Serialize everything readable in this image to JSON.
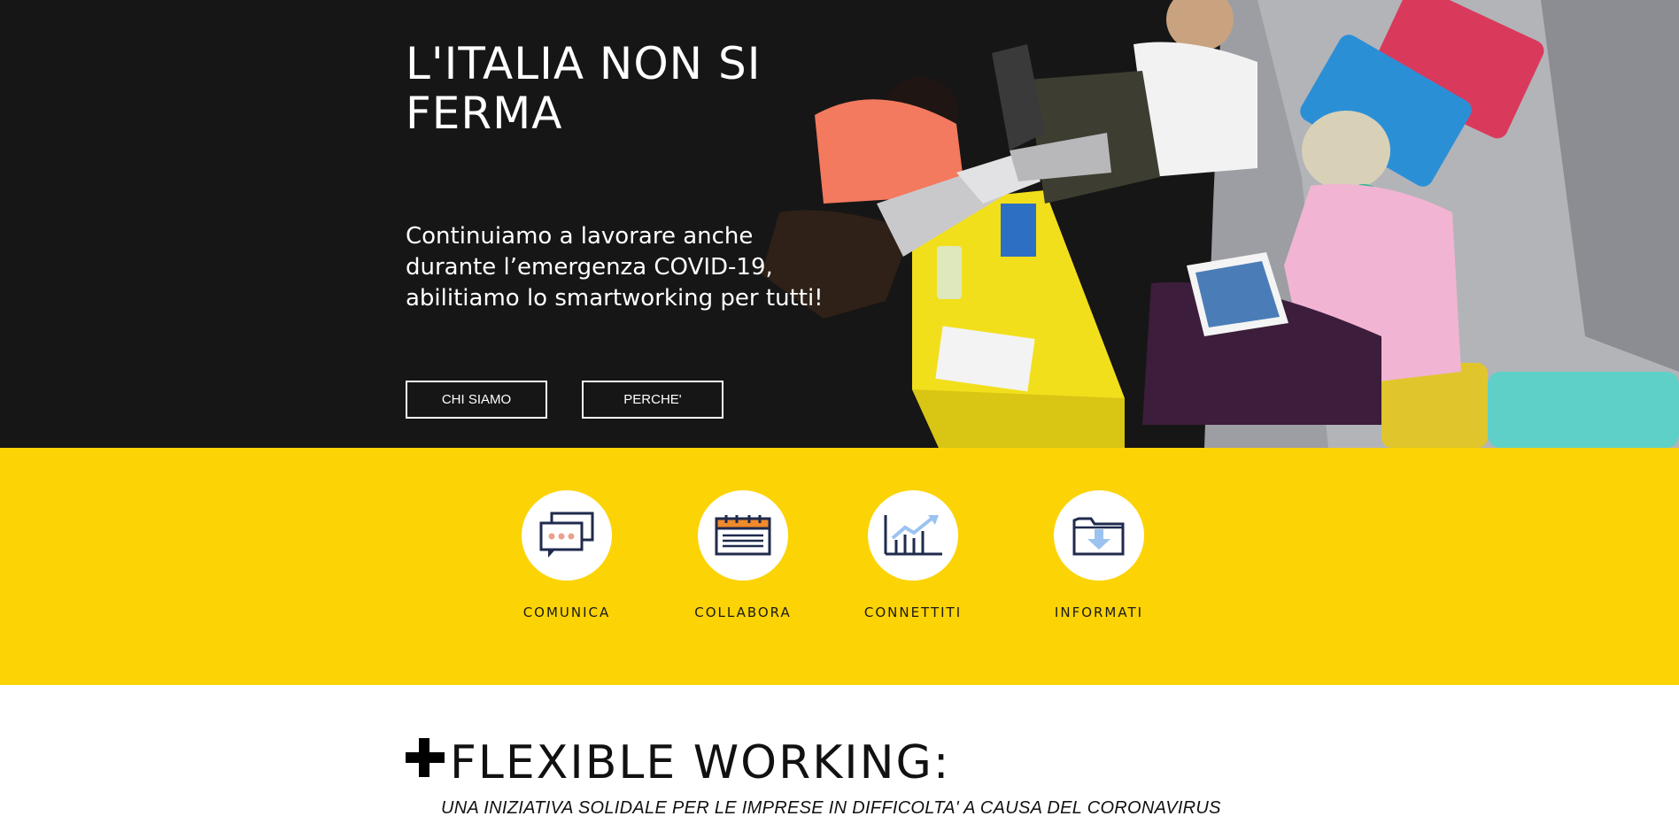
{
  "hero": {
    "title": "L'ITALIA NON SI FERMA",
    "subtitle": "Continuiamo a lavorare anche durante l’emergenza COVID-19, abilitiamo lo smartworking per tutti!",
    "buttons": {
      "chi_siamo": "CHI SIAMO",
      "perche": "PERCHE'"
    },
    "image": "people-working-with-laptops-on-sofa"
  },
  "features": [
    {
      "label": "COMUNICA",
      "icon": "chat-bubbles-icon"
    },
    {
      "label": "COLLABORA",
      "icon": "calendar-icon"
    },
    {
      "label": "CONNETTITI",
      "icon": "growth-chart-icon"
    },
    {
      "label": "INFORMATI",
      "icon": "folder-download-icon"
    }
  ],
  "section": {
    "title": "FLEXIBLE WORKING:",
    "subtitle": "UNA INIZIATIVA SOLIDALE PER LE IMPRESE IN DIFFICOLTA' A CAUSA DEL CORONAVIRUS"
  },
  "colors": {
    "accent_yellow": "#fcd305",
    "icon_navy": "#1f2a4d",
    "icon_orange": "#f08a2a",
    "icon_pink": "#e9a08c",
    "icon_light_blue": "#9cc3f0"
  }
}
